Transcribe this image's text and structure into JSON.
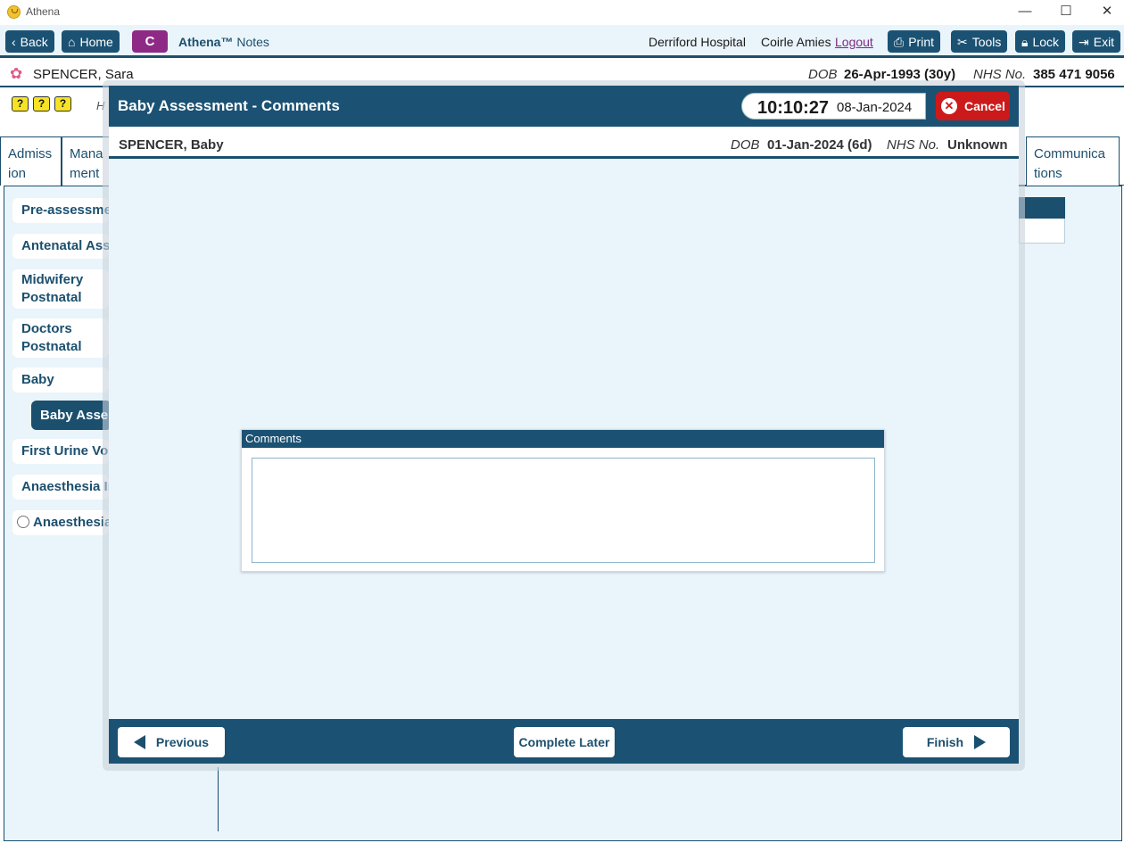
{
  "window": {
    "title": "Athena",
    "minimize": "—",
    "maximize": "☐",
    "close": "✕"
  },
  "toolbar": {
    "back": "Back",
    "home": "Home",
    "c_label": "C",
    "brand_name": "Athena™",
    "brand_suffix": "Notes",
    "hospital": "Derriford Hospital",
    "user": "Coirle Amies",
    "logout": "Logout",
    "print": "Print",
    "tools": "Tools",
    "lock": "Lock",
    "exit": "Exit"
  },
  "patient": {
    "name": "SPENCER, Sara",
    "dob_label": "DOB",
    "dob": "26-Apr-1993 (30y)",
    "nhs_label": "NHS No.",
    "nhs": "385 471 9056"
  },
  "alerts": [
    "?",
    "?",
    "?"
  ],
  "hint": "H",
  "tabs": {
    "left1": "Admiss ion",
    "left2": "Mana ment",
    "right1": "Communica tions"
  },
  "sidebar": {
    "items": [
      "Pre-assessment",
      "Antenatal Assessments",
      "Midwifery Postnatal Assessments",
      "Doctors Postnatal Assessments",
      "Baby",
      "Baby Assessment",
      "First Urine Void",
      "Anaesthesia Interventions",
      "Anaesthesia"
    ]
  },
  "modal": {
    "title": "Baby Assessment - Comments",
    "time": "10:10:27",
    "date": "08-Jan-2024",
    "cancel": "Cancel",
    "baby_name": "SPENCER, Baby",
    "dob_label": "DOB",
    "dob": "01-Jan-2024 (6d)",
    "nhs_label": "NHS No.",
    "nhs": "Unknown",
    "comments_label": "Comments",
    "comments_value": "",
    "previous": "Previous",
    "complete_later": "Complete Later",
    "finish": "Finish"
  },
  "colors": {
    "primary": "#1b5273",
    "accent_purple": "#8e2a86",
    "cancel_red": "#cc1a1a",
    "background": "#eaf4fb"
  }
}
